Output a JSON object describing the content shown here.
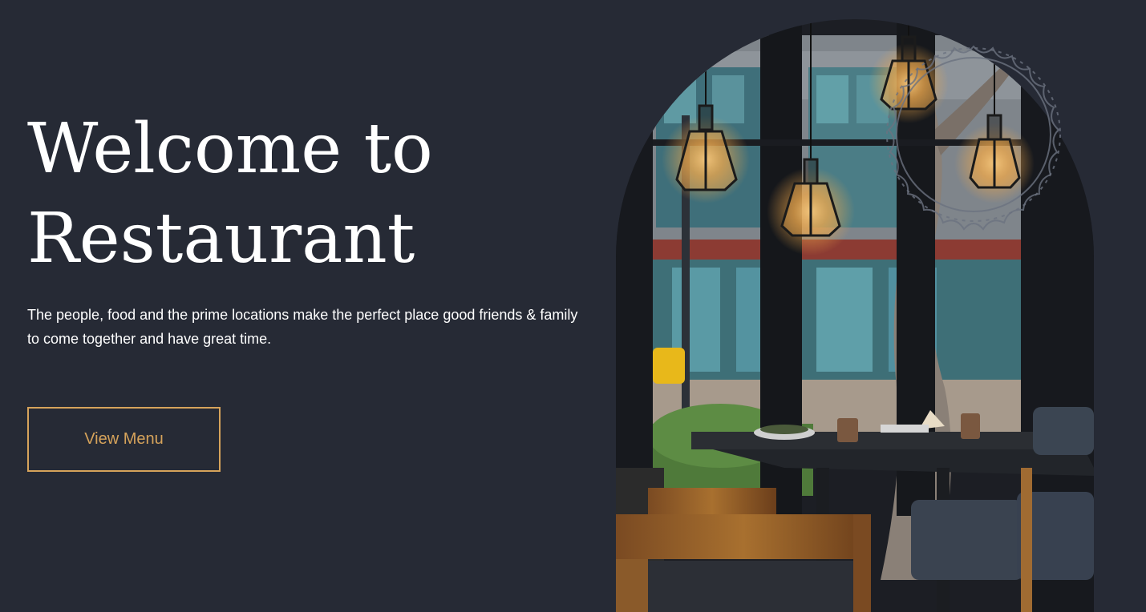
{
  "hero": {
    "title_line1": "Welcome to",
    "title_line2": "Restaurant",
    "description": "The people, food and the prime locations make the perfect place good friends & family to come together and have great time.",
    "button_label": "View Menu"
  },
  "colors": {
    "background": "#262a35",
    "text": "#ffffff",
    "accent": "#d6a35b"
  },
  "image": {
    "subject": "restaurant interior with pendant lamps, wooden chairs and a window view of a street"
  },
  "decoration": {
    "badge": "wavy circle outline"
  }
}
